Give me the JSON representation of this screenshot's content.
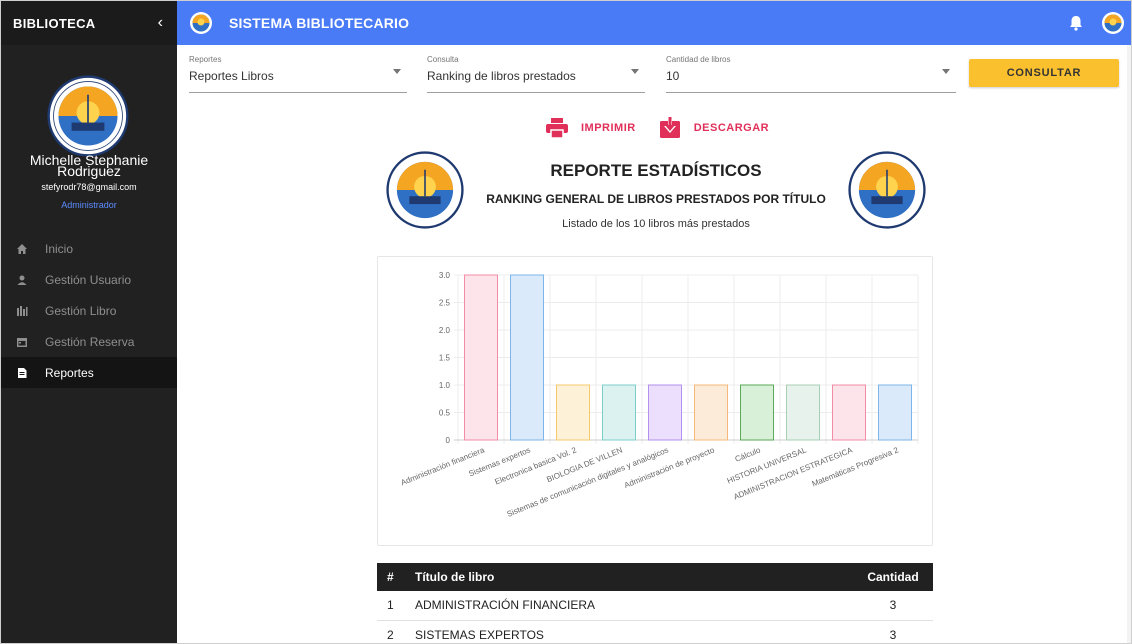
{
  "sidebar": {
    "title": "BIBLIOTECA",
    "collapse_icon": "chevron-left-icon",
    "logo": "armada-del-ecuador-logo",
    "user": {
      "first_name": "Michelle Stephanie",
      "last_name": "Rodriguez",
      "email": "stefyrodr78@gmail.com",
      "role": "Administrador"
    },
    "items": [
      {
        "label": "Inicio",
        "icon": "home-icon",
        "active": false
      },
      {
        "label": "Gestión Usuario",
        "icon": "user-icon",
        "active": false
      },
      {
        "label": "Gestión Libro",
        "icon": "books-icon",
        "active": false
      },
      {
        "label": "Gestión Reserva",
        "icon": "calendar-icon",
        "active": false
      },
      {
        "label": "Reportes",
        "icon": "file-icon",
        "active": true
      }
    ]
  },
  "topbar": {
    "title": "SISTEMA BIBLIOTECARIO",
    "bell_icon": "bell-icon",
    "avatar_icon": "user-avatar-icon"
  },
  "filters": {
    "reportes": {
      "label": "Reportes",
      "value": "Reportes Libros"
    },
    "consulta": {
      "label": "Consulta",
      "value": "Ranking de libros prestados"
    },
    "cantidad": {
      "label": "Cantidad de libros",
      "value": "10"
    },
    "consultar_label": "CONSULTAR"
  },
  "actions": {
    "print_label": "IMPRIMIR",
    "download_label": "DESCARGAR"
  },
  "report": {
    "title": "REPORTE ESTADÍSTICOS",
    "subtitle": "RANKING GENERAL DE LIBROS PRESTADOS POR TÍTULO",
    "description": "Listado de los 10 libros más prestados"
  },
  "chart_data": {
    "type": "bar",
    "categories": [
      "Administración financiera",
      "Sistemas expertos",
      "Electronica basica Vol. 2",
      "BIOLOGIA DE VILLEN",
      "Sistemas de comunicación digitales y analógicos",
      "Administración de proyecto",
      "Cálculo",
      "HISTORIA UNIVERSAL",
      "ADMINISTRACION ESTRATEGICA",
      "Matemáticas Progresiva 2"
    ],
    "values": [
      3,
      3,
      1,
      1,
      1,
      1,
      1,
      1,
      1,
      1
    ],
    "yticks": [
      "0",
      "0.5",
      "1.0",
      "1.5",
      "2.0",
      "2.5",
      "3.0"
    ],
    "ylim": [
      0,
      3
    ],
    "grid": true,
    "colors": [
      {
        "fill": "#fde3ea",
        "stroke": "#f28ba6"
      },
      {
        "fill": "#dbeafa",
        "stroke": "#7bb5ea"
      },
      {
        "fill": "#fdf1d8",
        "stroke": "#f5c96b"
      },
      {
        "fill": "#dcf2f1",
        "stroke": "#7ccdc8"
      },
      {
        "fill": "#ebdffd",
        "stroke": "#b38ff0"
      },
      {
        "fill": "#fdebd9",
        "stroke": "#f5b87a"
      },
      {
        "fill": "#d8efd8",
        "stroke": "#5aaa5a"
      },
      {
        "fill": "#e8f2ec",
        "stroke": "#a8cfb5"
      },
      {
        "fill": "#fde3ea",
        "stroke": "#f28ba6"
      },
      {
        "fill": "#dbeafa",
        "stroke": "#7bb5ea"
      }
    ]
  },
  "table": {
    "headers": {
      "num": "#",
      "title": "Título de libro",
      "count": "Cantidad"
    },
    "rows": [
      {
        "num": "1",
        "title": "ADMINISTRACIÓN FINANCIERA",
        "count": "3"
      },
      {
        "num": "2",
        "title": "SISTEMAS EXPERTOS",
        "count": "3"
      }
    ]
  }
}
